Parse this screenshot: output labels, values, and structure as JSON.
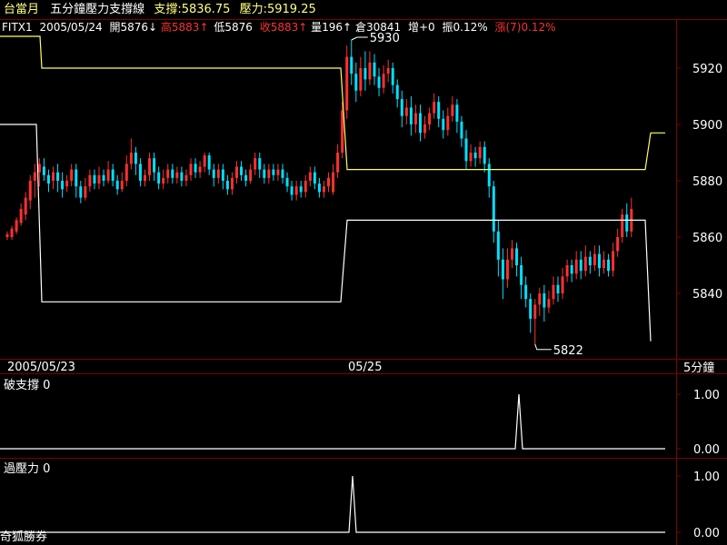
{
  "header": {
    "symbol": "台當月",
    "indicator_title": "五分鐘壓力支撐線",
    "support_label": "支撐:5836.75",
    "resist_label": "壓力:5919.25",
    "code": "FITX1",
    "date": "2005/05/24",
    "open": "開5876↓",
    "high": "高5883↑",
    "low": "低5876",
    "close": "收5883↑",
    "volume": "量196↑",
    "oi": "倉30841",
    "oi_change": "增+0",
    "amplitude": "振0.12%",
    "change": "漲(7)0.12%"
  },
  "colors": {
    "background": "#000000",
    "frame": "#800000",
    "text": "#ffffff",
    "gold": "#ffff80",
    "red": "#ff3030",
    "up_candle": "#ff3030",
    "down_candle": "#00e0ff",
    "resistance_line": "#ffff60",
    "support_line": "#ffffff"
  },
  "x_axis": {
    "left_date": "2005/05/23",
    "mid_date": "05/25",
    "interval": "5分鐘"
  },
  "panel2": {
    "label": "破支撐 0"
  },
  "panel3": {
    "label": "過壓力 0"
  },
  "watermark": "奇狐勝券",
  "chart_data": [
    {
      "type": "candlestick",
      "title": "五分鐘壓力支撐線",
      "ylim": [
        5820,
        5935
      ],
      "yticks": [
        5840,
        5860,
        5880,
        5900,
        5920
      ],
      "high_mark": 5930,
      "low_mark": 5822,
      "candles": [
        [
          5860,
          5861,
          5859,
          5862
        ],
        [
          5860,
          5863,
          5859,
          5864
        ],
        [
          5862,
          5866,
          5861,
          5867
        ],
        [
          5865,
          5870,
          5864,
          5872
        ],
        [
          5868,
          5874,
          5866,
          5876
        ],
        [
          5873,
          5880,
          5870,
          5882
        ],
        [
          5880,
          5883,
          5874,
          5886
        ],
        [
          5883,
          5886,
          5878,
          5888
        ],
        [
          5885,
          5882,
          5880,
          5888
        ],
        [
          5882,
          5879,
          5876,
          5884
        ],
        [
          5880,
          5883,
          5877,
          5885
        ],
        [
          5883,
          5880,
          5876,
          5886
        ],
        [
          5880,
          5877,
          5874,
          5883
        ],
        [
          5878,
          5880,
          5876,
          5882
        ],
        [
          5880,
          5884,
          5878,
          5886
        ],
        [
          5884,
          5878,
          5874,
          5886
        ],
        [
          5878,
          5874,
          5872,
          5880
        ],
        [
          5874,
          5878,
          5873,
          5881
        ],
        [
          5878,
          5882,
          5876,
          5884
        ],
        [
          5882,
          5879,
          5877,
          5884
        ],
        [
          5879,
          5882,
          5877,
          5885
        ],
        [
          5882,
          5880,
          5878,
          5884
        ],
        [
          5880,
          5884,
          5879,
          5887
        ],
        [
          5884,
          5880,
          5878,
          5886
        ],
        [
          5880,
          5877,
          5875,
          5882
        ],
        [
          5877,
          5880,
          5876,
          5883
        ],
        [
          5880,
          5886,
          5878,
          5889
        ],
        [
          5886,
          5890,
          5884,
          5895
        ],
        [
          5890,
          5886,
          5882,
          5892
        ],
        [
          5886,
          5880,
          5878,
          5888
        ],
        [
          5880,
          5882,
          5878,
          5884
        ],
        [
          5882,
          5888,
          5880,
          5890
        ],
        [
          5888,
          5883,
          5880,
          5890
        ],
        [
          5883,
          5879,
          5877,
          5885
        ],
        [
          5879,
          5881,
          5877,
          5884
        ],
        [
          5881,
          5884,
          5879,
          5886
        ],
        [
          5884,
          5881,
          5879,
          5886
        ],
        [
          5881,
          5883,
          5879,
          5885
        ],
        [
          5883,
          5880,
          5878,
          5885
        ],
        [
          5880,
          5882,
          5878,
          5884
        ],
        [
          5882,
          5886,
          5880,
          5888
        ],
        [
          5886,
          5883,
          5881,
          5888
        ],
        [
          5883,
          5885,
          5881,
          5887
        ],
        [
          5885,
          5889,
          5883,
          5890
        ],
        [
          5889,
          5884,
          5882,
          5890
        ],
        [
          5884,
          5881,
          5878,
          5886
        ],
        [
          5881,
          5884,
          5879,
          5886
        ],
        [
          5884,
          5880,
          5877,
          5886
        ],
        [
          5880,
          5877,
          5875,
          5882
        ],
        [
          5877,
          5881,
          5875,
          5883
        ],
        [
          5881,
          5885,
          5879,
          5887
        ],
        [
          5885,
          5882,
          5880,
          5887
        ],
        [
          5882,
          5880,
          5878,
          5884
        ],
        [
          5880,
          5884,
          5879,
          5886
        ],
        [
          5884,
          5888,
          5882,
          5890
        ],
        [
          5888,
          5884,
          5881,
          5890
        ],
        [
          5884,
          5881,
          5879,
          5886
        ],
        [
          5881,
          5884,
          5879,
          5886
        ],
        [
          5884,
          5882,
          5880,
          5886
        ],
        [
          5882,
          5884,
          5880,
          5886
        ],
        [
          5884,
          5881,
          5879,
          5886
        ],
        [
          5881,
          5878,
          5876,
          5883
        ],
        [
          5878,
          5875,
          5873,
          5880
        ],
        [
          5875,
          5878,
          5873,
          5880
        ],
        [
          5878,
          5876,
          5874,
          5880
        ],
        [
          5876,
          5880,
          5874,
          5882
        ],
        [
          5880,
          5883,
          5878,
          5885
        ],
        [
          5883,
          5879,
          5877,
          5885
        ],
        [
          5879,
          5876,
          5874,
          5881
        ],
        [
          5876,
          5878,
          5874,
          5880
        ],
        [
          5878,
          5881,
          5876,
          5883
        ],
        [
          5876,
          5883,
          5875,
          5886
        ],
        [
          5883,
          5890,
          5881,
          5893
        ],
        [
          5890,
          5905,
          5888,
          5908
        ],
        [
          5905,
          5924,
          5902,
          5928
        ],
        [
          5924,
          5918,
          5914,
          5930
        ],
        [
          5918,
          5912,
          5908,
          5922
        ],
        [
          5912,
          5920,
          5910,
          5924
        ],
        [
          5920,
          5916,
          5912,
          5926
        ],
        [
          5916,
          5922,
          5914,
          5926
        ],
        [
          5922,
          5917,
          5914,
          5925
        ],
        [
          5917,
          5913,
          5910,
          5920
        ],
        [
          5913,
          5918,
          5911,
          5921
        ],
        [
          5918,
          5920,
          5915,
          5923
        ],
        [
          5920,
          5914,
          5911,
          5922
        ],
        [
          5914,
          5909,
          5906,
          5916
        ],
        [
          5909,
          5903,
          5899,
          5912
        ],
        [
          5903,
          5906,
          5900,
          5909
        ],
        [
          5906,
          5900,
          5896,
          5910
        ],
        [
          5900,
          5904,
          5897,
          5907
        ],
        [
          5904,
          5897,
          5894,
          5907
        ],
        [
          5897,
          5900,
          5895,
          5903
        ],
        [
          5900,
          5904,
          5898,
          5906
        ],
        [
          5904,
          5908,
          5902,
          5911
        ],
        [
          5908,
          5902,
          5899,
          5910
        ],
        [
          5902,
          5898,
          5895,
          5905
        ],
        [
          5898,
          5903,
          5896,
          5906
        ],
        [
          5903,
          5907,
          5901,
          5910
        ],
        [
          5907,
          5901,
          5897,
          5909
        ],
        [
          5901,
          5895,
          5892,
          5903
        ],
        [
          5895,
          5887,
          5884,
          5898
        ],
        [
          5887,
          5890,
          5885,
          5893
        ],
        [
          5890,
          5888,
          5885,
          5892
        ],
        [
          5888,
          5892,
          5886,
          5894
        ],
        [
          5892,
          5886,
          5883,
          5894
        ],
        [
          5886,
          5878,
          5874,
          5888
        ],
        [
          5878,
          5862,
          5858,
          5880
        ],
        [
          5862,
          5852,
          5846,
          5866
        ],
        [
          5852,
          5845,
          5838,
          5856
        ],
        [
          5845,
          5852,
          5842,
          5856
        ],
        [
          5852,
          5856,
          5849,
          5859
        ],
        [
          5856,
          5850,
          5846,
          5858
        ],
        [
          5850,
          5843,
          5838,
          5853
        ],
        [
          5843,
          5838,
          5835,
          5846
        ],
        [
          5838,
          5831,
          5826,
          5840
        ],
        [
          5831,
          5836,
          5822,
          5838
        ],
        [
          5836,
          5840,
          5832,
          5842
        ],
        [
          5840,
          5835,
          5830,
          5843
        ],
        [
          5835,
          5838,
          5833,
          5841
        ],
        [
          5838,
          5843,
          5836,
          5846
        ],
        [
          5843,
          5840,
          5837,
          5846
        ],
        [
          5840,
          5846,
          5838,
          5849
        ],
        [
          5846,
          5850,
          5844,
          5852
        ],
        [
          5850,
          5847,
          5844,
          5852
        ],
        [
          5847,
          5852,
          5845,
          5855
        ],
        [
          5852,
          5848,
          5845,
          5855
        ],
        [
          5848,
          5853,
          5846,
          5857
        ],
        [
          5853,
          5850,
          5847,
          5855
        ],
        [
          5850,
          5854,
          5848,
          5857
        ],
        [
          5854,
          5849,
          5846,
          5857
        ],
        [
          5849,
          5852,
          5847,
          5855
        ],
        [
          5852,
          5848,
          5846,
          5854
        ],
        [
          5848,
          5855,
          5846,
          5858
        ],
        [
          5855,
          5860,
          5853,
          5863
        ],
        [
          5860,
          5868,
          5858,
          5870
        ],
        [
          5868,
          5862,
          5860,
          5872
        ],
        [
          5862,
          5870,
          5860,
          5874
        ]
      ],
      "resistance": [
        [
          0,
          5940
        ],
        [
          44,
          5940
        ],
        [
          46,
          5920
        ],
        [
          375,
          5920
        ],
        [
          382,
          5884
        ],
        [
          710,
          5884
        ],
        [
          716,
          5897
        ],
        [
          732,
          5897
        ]
      ],
      "support": [
        [
          0,
          5900
        ],
        [
          40,
          5900
        ],
        [
          46,
          5837
        ],
        [
          375,
          5837
        ],
        [
          382,
          5866
        ],
        [
          710,
          5866
        ],
        [
          716,
          5823
        ]
      ]
    },
    {
      "type": "line",
      "title": "破支撐",
      "ylim": [
        0,
        1
      ],
      "yticks": [
        0,
        1
      ],
      "spikes": [
        571
      ]
    },
    {
      "type": "line",
      "title": "過壓力",
      "ylim": [
        0,
        1
      ],
      "yticks": [
        0,
        1
      ],
      "spikes": [
        388
      ]
    }
  ]
}
